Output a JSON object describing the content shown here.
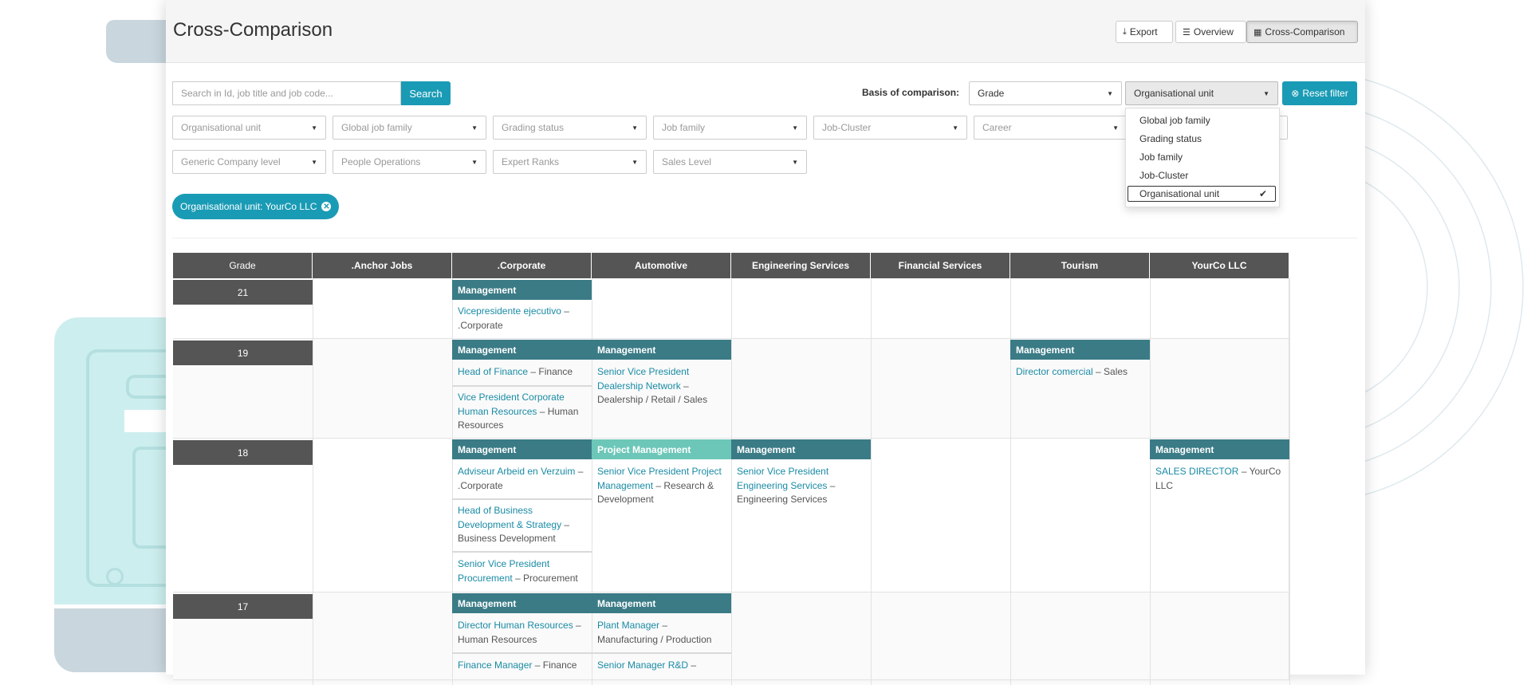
{
  "header": {
    "title": "Cross-Comparison",
    "buttons": {
      "export": "Export",
      "overview": "Overview",
      "cross_comparison": "Cross-Comparison"
    }
  },
  "search": {
    "placeholder": "Search in Id, job title and job code...",
    "button": "Search"
  },
  "basis": {
    "label": "Basis of comparison:",
    "first_value": "Grade",
    "second_value": "Organisational unit",
    "reset": "Reset filter",
    "options": [
      "Global job family",
      "Grading status",
      "Job family",
      "Job-Cluster",
      "Organisational unit"
    ],
    "selected_option": "Organisational unit"
  },
  "filters": {
    "row1": [
      "Organisational unit",
      "Global job family",
      "Grading status",
      "Job family",
      "Job-Cluster",
      "Career"
    ],
    "row2": [
      "Generic Company level",
      "People Operations",
      "Expert Ranks",
      "Sales Level"
    ]
  },
  "active_filter": "Organisational unit: YourCo LLC",
  "table": {
    "columns": [
      "Grade",
      ".Anchor Jobs",
      ".Corporate",
      "Automotive",
      "Engineering Services",
      "Financial Services",
      "Tourism",
      "YourCo LLC"
    ],
    "grades": [
      "21",
      "19",
      "18",
      "17"
    ],
    "family_labels": {
      "management": "Management",
      "project_management": "Project Management"
    },
    "jobs": {
      "g21_corporate_1": {
        "title": "Vicepresidente ejecutivo",
        "sep": " – ",
        "unit": ".Corporate"
      },
      "g19_corporate_1": {
        "title": "Head of Finance",
        "sep": " – ",
        "unit": "Finance"
      },
      "g19_corporate_2": {
        "title": "Vice President Corporate Human Resources",
        "sep": " – ",
        "unit": "Human Resources"
      },
      "g19_automotive_1": {
        "title": "Senior Vice President Dealership Network",
        "sep": " – ",
        "unit": "Dealership / Retail / Sales"
      },
      "g19_tourism_1": {
        "title": "Director comercial",
        "sep": " – ",
        "unit": "Sales"
      },
      "g18_corporate_1": {
        "title": "Adviseur Arbeid en Verzuim",
        "sep": " – ",
        "unit": ".Corporate"
      },
      "g18_corporate_2": {
        "title": "Head of Business Development & Strategy",
        "sep": " – ",
        "unit": "Business Development"
      },
      "g18_corporate_3": {
        "title": "Senior Vice President Procurement",
        "sep": " – ",
        "unit": "Procurement"
      },
      "g18_automotive_1": {
        "title": "Senior Vice President Project Management",
        "sep": " – ",
        "unit": "Research & Development"
      },
      "g18_engineering_1": {
        "title": "Senior Vice President Engineering Services",
        "sep": " – ",
        "unit": "Engineering Services"
      },
      "g18_yourco_1": {
        "title": "SALES DIRECTOR",
        "sep": " – ",
        "unit": "YourCo LLC"
      },
      "g17_corporate_1": {
        "title": "Director Human Resources",
        "sep": " – ",
        "unit": "Human Resources"
      },
      "g17_corporate_2": {
        "title": "Finance Manager",
        "sep": " – ",
        "unit": "Finance"
      },
      "g17_automotive_1": {
        "title": "Plant Manager",
        "sep": " – ",
        "unit": "Manufacturing / Production"
      },
      "g17_automotive_2": {
        "title": "Senior Manager R&D",
        "sep": " –",
        "unit": ""
      }
    }
  },
  "colors": {
    "accent": "#1a9bb5",
    "family_header": "#3a7b86",
    "family_header_light": "#6cc7b8",
    "grade_header": "#555555",
    "link": "#1a8ba5"
  }
}
